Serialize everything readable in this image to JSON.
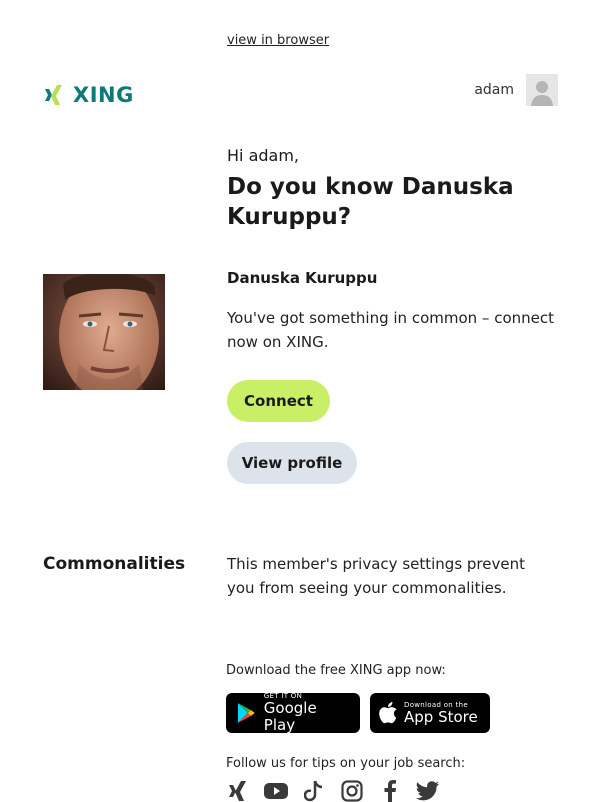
{
  "header": {
    "view_in_browser": "view in browser",
    "logo_text": "XING",
    "user_name": "adam"
  },
  "main": {
    "greeting": "Hi adam,",
    "headline": "Do you know Danuska Kuruppu?",
    "contact_name": "Danuska Kuruppu",
    "message": "You've got something in common – connect now on XING.",
    "connect_label": "Connect",
    "view_profile_label": "View profile"
  },
  "commonalities": {
    "label": "Commonalities",
    "text": "This member's privacy settings prevent you from seeing your commonalities."
  },
  "footer": {
    "download_label": "Download the free XING app now:",
    "google_play_small": "GET IT ON",
    "google_play_big": "Google Play",
    "app_store_small": "Download on the",
    "app_store_big": "App Store",
    "follow_label": "Follow us for tips on your job search:",
    "social_icons": [
      "xing-icon",
      "youtube-icon",
      "tiktok-icon",
      "instagram-icon",
      "facebook-icon",
      "twitter-icon"
    ]
  },
  "colors": {
    "brand": "#0c7a7a",
    "brand_light": "#c9ef66",
    "connect_bg": "#c9ef66",
    "profile_bg": "#dde3ea"
  }
}
